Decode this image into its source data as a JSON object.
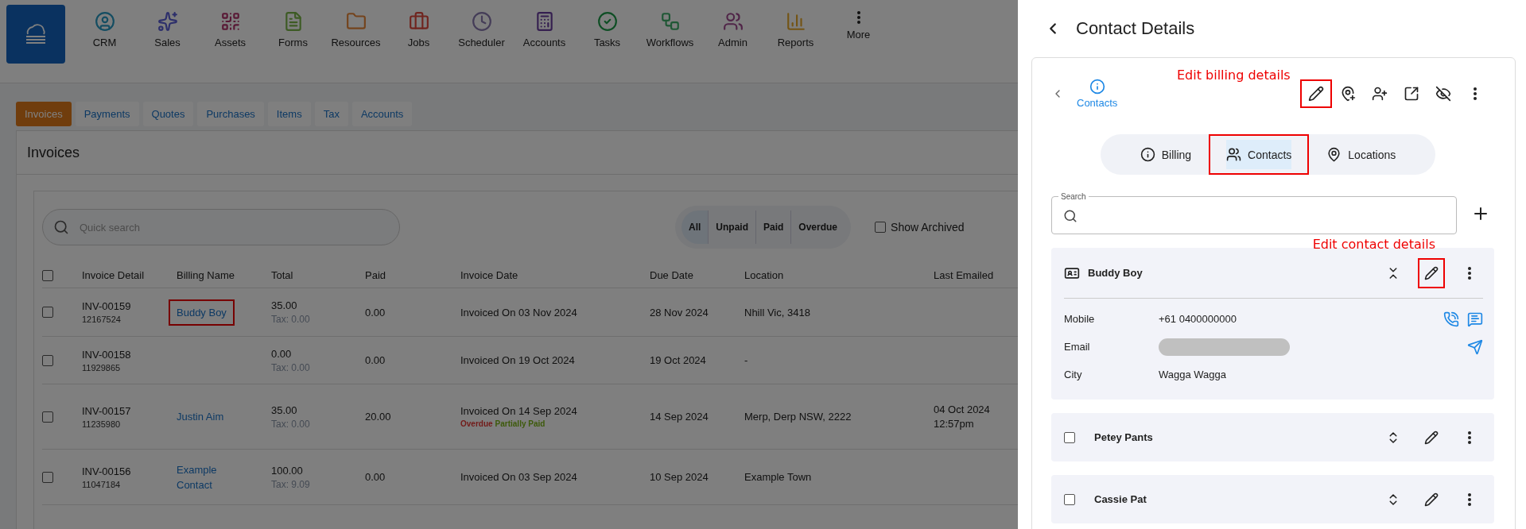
{
  "nav": {
    "items": [
      {
        "label": "CRM"
      },
      {
        "label": "Sales"
      },
      {
        "label": "Assets"
      },
      {
        "label": "Forms"
      },
      {
        "label": "Resources"
      },
      {
        "label": "Jobs"
      },
      {
        "label": "Scheduler"
      },
      {
        "label": "Accounts"
      },
      {
        "label": "Tasks"
      },
      {
        "label": "Workflows"
      },
      {
        "label": "Admin"
      },
      {
        "label": "Reports"
      },
      {
        "label": "More"
      }
    ]
  },
  "tabs": [
    {
      "label": "Invoices",
      "selected": true
    },
    {
      "label": "Payments",
      "selected": false
    },
    {
      "label": "Quotes",
      "selected": false
    },
    {
      "label": "Purchases",
      "selected": false
    },
    {
      "label": "Items",
      "selected": false
    },
    {
      "label": "Tax",
      "selected": false
    },
    {
      "label": "Accounts",
      "selected": false
    }
  ],
  "panel_title": "Invoices",
  "search": {
    "placeholder": "Quick search"
  },
  "filters": [
    {
      "label": "All",
      "selected": true
    },
    {
      "label": "Unpaid",
      "selected": false
    },
    {
      "label": "Paid",
      "selected": false
    },
    {
      "label": "Overdue",
      "selected": false
    }
  ],
  "show_archived": {
    "label": "Show Archived",
    "checked": false
  },
  "table": {
    "select_all": {
      "checked": false
    },
    "columns": [
      "Invoice Detail",
      "Billing Name",
      "Total",
      "Paid",
      "Invoice Date",
      "Due Date",
      "Location",
      "Last Emailed"
    ],
    "rows": [
      {
        "checked": false,
        "number": "INV-00159",
        "ref": "12167524",
        "billing_name": {
          "text": "Buddy Boy",
          "highlighted": true
        },
        "total": "35.00",
        "tax": "Tax: 0.00",
        "paid": "0.00",
        "invoice_date": "Invoiced On 03 Nov 2024",
        "tags": [],
        "due_date": "28 Nov 2024",
        "location": "Nhill Vic, 3418",
        "last_emailed": []
      },
      {
        "checked": false,
        "number": "INV-00158",
        "ref": "11929865",
        "total": "0.00",
        "tax": "Tax: 0.00",
        "paid": "0.00",
        "invoice_date": "Invoiced On 19 Oct 2024",
        "tags": [],
        "due_date": "19 Oct 2024",
        "location": "-",
        "last_emailed": []
      },
      {
        "checked": false,
        "number": "INV-00157",
        "ref": "11235980",
        "billing_name": {
          "text": "Justin Aim",
          "highlighted": false
        },
        "total": "35.00",
        "tax": "Tax: 0.00",
        "paid": "20.00",
        "invoice_date": "Invoiced On 14 Sep 2024",
        "tags": [
          {
            "label": "Overdue",
            "kind": "overdue"
          },
          {
            "label": "Partially Paid",
            "kind": "partial"
          }
        ],
        "due_date": "14 Sep 2024",
        "location": "Merp, Derp NSW, 2222",
        "last_emailed": [
          "04 Oct 2024",
          "12:57pm"
        ]
      },
      {
        "checked": false,
        "number": "INV-00156",
        "ref": "11047184",
        "billing_name": {
          "text": "Example Contact",
          "highlighted": false
        },
        "total": "100.00",
        "tax": "Tax: 9.09",
        "paid": "0.00",
        "invoice_date": "Invoiced On 03 Sep 2024",
        "tags": [],
        "due_date": "10 Sep 2024",
        "location": "Example Town",
        "last_emailed": []
      }
    ]
  },
  "drawer": {
    "title": "Contact Details",
    "section": "Contacts",
    "toolbar": [
      {
        "highlighted": true
      },
      {
        "highlighted": false
      },
      {
        "highlighted": false
      },
      {
        "highlighted": false
      },
      {
        "highlighted": false
      },
      {
        "highlighted": false
      }
    ],
    "toolbar_note": "Edit billing details",
    "tabs": [
      {
        "label": "Billing",
        "selected": false,
        "highlighted": false
      },
      {
        "label": "Contacts",
        "selected": true,
        "highlighted": true
      },
      {
        "label": "Locations",
        "selected": false,
        "highlighted": false
      }
    ],
    "search": {
      "label": "Search"
    },
    "contact_note": "Edit contact details",
    "contacts": [
      {
        "name": "Buddy Boy",
        "expanded": true,
        "edit_highlighted": true,
        "fields": [
          {
            "label": "Mobile",
            "kind": "phone",
            "value": "+61 0400000000"
          },
          {
            "label": "Email",
            "kind": "redacted"
          },
          {
            "label": "City",
            "kind": "text",
            "value": "Wagga Wagga"
          }
        ]
      },
      {
        "name": "Petey Pants",
        "expanded": false,
        "checked": false,
        "edit_highlighted": false
      },
      {
        "name": "Cassie Pat",
        "expanded": false,
        "checked": false,
        "edit_highlighted": false
      }
    ]
  }
}
